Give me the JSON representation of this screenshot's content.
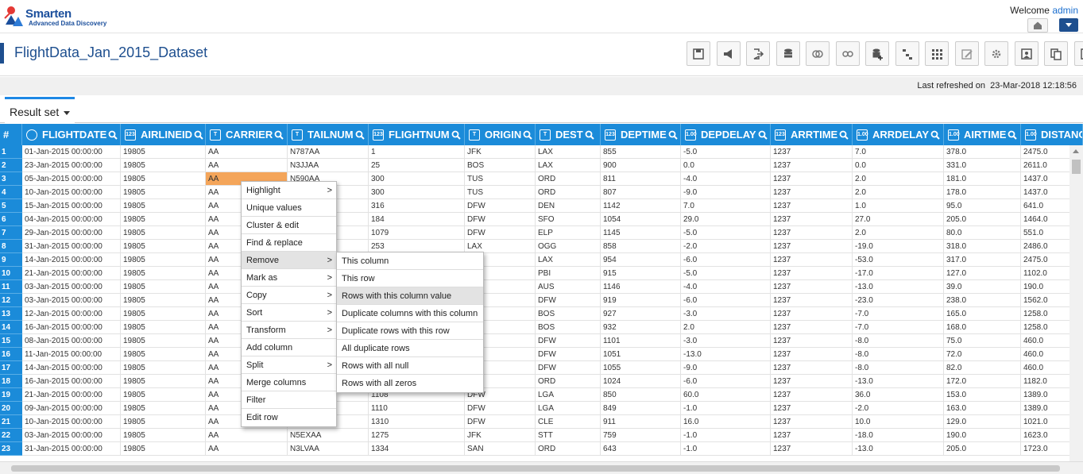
{
  "app": {
    "brand": "Smarten",
    "tagline": "Advanced Data Discovery"
  },
  "header": {
    "welcome": "Welcome",
    "user": "admin"
  },
  "page": {
    "title": "FlightData_Jan_2015_Dataset",
    "last_refreshed_label": "Last refreshed on",
    "last_refreshed_value": "23-Mar-2018 12:18:56"
  },
  "toolbar": {
    "icons": [
      "save-icon",
      "megaphone-icon",
      "export-icon",
      "database-icon",
      "circles-icon",
      "link-icon",
      "add-db-icon",
      "hierarchy-icon",
      "grid-icon",
      "edit-image-icon",
      "settings-icon",
      "picture-icon",
      "copy-icon",
      "columns-icon"
    ]
  },
  "tabs": {
    "result_set": "Result set"
  },
  "columns": [
    {
      "name": "#",
      "type": ""
    },
    {
      "name": "FLIGHTDATE",
      "type": "clock"
    },
    {
      "name": "AIRLINEID",
      "type": "123"
    },
    {
      "name": "CARRIER",
      "type": "T"
    },
    {
      "name": "TAILNUM",
      "type": "T"
    },
    {
      "name": "FLIGHTNUM",
      "type": "123"
    },
    {
      "name": "ORIGIN",
      "type": "T"
    },
    {
      "name": "DEST",
      "type": "T"
    },
    {
      "name": "DEPTIME",
      "type": "123"
    },
    {
      "name": "DEPDELAY",
      "type": "1.00"
    },
    {
      "name": "ARRTIME",
      "type": "123"
    },
    {
      "name": "ARRDELAY",
      "type": "1.00"
    },
    {
      "name": "AIRTIME",
      "type": "1.00"
    },
    {
      "name": "DISTANC",
      "type": "1.00"
    }
  ],
  "rows": [
    [
      "1",
      "01-Jan-2015 00:00:00",
      "19805",
      "AA",
      "N787AA",
      "1",
      "JFK",
      "LAX",
      "855",
      "-5.0",
      "1237",
      "7.0",
      "378.0",
      "2475.0"
    ],
    [
      "2",
      "23-Jan-2015 00:00:00",
      "19805",
      "AA",
      "N3JJAA",
      "25",
      "BOS",
      "LAX",
      "900",
      "0.0",
      "1237",
      "0.0",
      "331.0",
      "2611.0"
    ],
    [
      "3",
      "05-Jan-2015 00:00:00",
      "19805",
      "AA",
      "N590AA",
      "300",
      "TUS",
      "ORD",
      "811",
      "-4.0",
      "1237",
      "2.0",
      "181.0",
      "1437.0"
    ],
    [
      "4",
      "10-Jan-2015 00:00:00",
      "19805",
      "AA",
      "",
      "300",
      "TUS",
      "ORD",
      "807",
      "-9.0",
      "1237",
      "2.0",
      "178.0",
      "1437.0"
    ],
    [
      "5",
      "15-Jan-2015 00:00:00",
      "19805",
      "AA",
      "",
      "316",
      "DFW",
      "DEN",
      "1142",
      "7.0",
      "1237",
      "1.0",
      "95.0",
      "641.0"
    ],
    [
      "6",
      "04-Jan-2015 00:00:00",
      "19805",
      "AA",
      "",
      "184",
      "DFW",
      "SFO",
      "1054",
      "29.0",
      "1237",
      "27.0",
      "205.0",
      "1464.0"
    ],
    [
      "7",
      "29-Jan-2015 00:00:00",
      "19805",
      "AA",
      "",
      "1079",
      "DFW",
      "ELP",
      "1145",
      "-5.0",
      "1237",
      "2.0",
      "80.0",
      "551.0"
    ],
    [
      "8",
      "31-Jan-2015 00:00:00",
      "19805",
      "AA",
      "",
      "253",
      "LAX",
      "OGG",
      "858",
      "-2.0",
      "1237",
      "-19.0",
      "318.0",
      "2486.0"
    ],
    [
      "9",
      "14-Jan-2015 00:00:00",
      "19805",
      "AA",
      "",
      "",
      "",
      "LAX",
      "954",
      "-6.0",
      "1237",
      "-53.0",
      "317.0",
      "2475.0"
    ],
    [
      "10",
      "21-Jan-2015 00:00:00",
      "19805",
      "AA",
      "",
      "",
      "",
      "PBI",
      "915",
      "-5.0",
      "1237",
      "-17.0",
      "127.0",
      "1102.0"
    ],
    [
      "11",
      "03-Jan-2015 00:00:00",
      "19805",
      "AA",
      "",
      "",
      "",
      "AUS",
      "1146",
      "-4.0",
      "1237",
      "-13.0",
      "39.0",
      "190.0"
    ],
    [
      "12",
      "03-Jan-2015 00:00:00",
      "19805",
      "AA",
      "",
      "",
      "",
      "DFW",
      "919",
      "-6.0",
      "1237",
      "-23.0",
      "238.0",
      "1562.0"
    ],
    [
      "13",
      "12-Jan-2015 00:00:00",
      "19805",
      "AA",
      "",
      "",
      "",
      "BOS",
      "927",
      "-3.0",
      "1237",
      "-7.0",
      "165.0",
      "1258.0"
    ],
    [
      "14",
      "16-Jan-2015 00:00:00",
      "19805",
      "AA",
      "",
      "",
      "",
      "BOS",
      "932",
      "2.0",
      "1237",
      "-7.0",
      "168.0",
      "1258.0"
    ],
    [
      "15",
      "08-Jan-2015 00:00:00",
      "19805",
      "AA",
      "",
      "",
      "",
      "DFW",
      "1101",
      "-3.0",
      "1237",
      "-8.0",
      "75.0",
      "460.0"
    ],
    [
      "16",
      "11-Jan-2015 00:00:00",
      "19805",
      "AA",
      "",
      "",
      "",
      "DFW",
      "1051",
      "-13.0",
      "1237",
      "-8.0",
      "72.0",
      "460.0"
    ],
    [
      "17",
      "14-Jan-2015 00:00:00",
      "19805",
      "AA",
      "",
      "",
      "",
      "DFW",
      "1055",
      "-9.0",
      "1237",
      "-8.0",
      "82.0",
      "460.0"
    ],
    [
      "18",
      "16-Jan-2015 00:00:00",
      "19805",
      "AA",
      "",
      "",
      "",
      "ORD",
      "1024",
      "-6.0",
      "1237",
      "-13.0",
      "172.0",
      "1182.0"
    ],
    [
      "19",
      "21-Jan-2015 00:00:00",
      "19805",
      "AA",
      "",
      "1108",
      "DFW",
      "LGA",
      "850",
      "60.0",
      "1237",
      "36.0",
      "153.0",
      "1389.0"
    ],
    [
      "20",
      "09-Jan-2015 00:00:00",
      "19805",
      "AA",
      "",
      "1110",
      "DFW",
      "LGA",
      "849",
      "-1.0",
      "1237",
      "-2.0",
      "163.0",
      "1389.0"
    ],
    [
      "21",
      "10-Jan-2015 00:00:00",
      "19805",
      "AA",
      "",
      "1310",
      "DFW",
      "CLE",
      "911",
      "16.0",
      "1237",
      "10.0",
      "129.0",
      "1021.0"
    ],
    [
      "22",
      "03-Jan-2015 00:00:00",
      "19805",
      "AA",
      "N5EXAA",
      "1275",
      "JFK",
      "STT",
      "759",
      "-1.0",
      "1237",
      "-18.0",
      "190.0",
      "1623.0"
    ],
    [
      "23",
      "31-Jan-2015 00:00:00",
      "19805",
      "AA",
      "N3LVAA",
      "1334",
      "SAN",
      "ORD",
      "643",
      "-1.0",
      "1237",
      "-13.0",
      "205.0",
      "1723.0"
    ]
  ],
  "context_menu": {
    "items": [
      {
        "label": "Highlight",
        "arrow": ">"
      },
      {
        "label": "Unique values",
        "arrow": ""
      },
      {
        "label": "Cluster & edit",
        "arrow": ""
      },
      {
        "label": "Find & replace",
        "arrow": ""
      },
      {
        "label": "Remove",
        "arrow": ">"
      },
      {
        "label": "Mark as",
        "arrow": ">"
      },
      {
        "label": "Copy",
        "arrow": ">"
      },
      {
        "label": "Sort",
        "arrow": ">"
      },
      {
        "label": "Transform",
        "arrow": ">"
      },
      {
        "label": "Add column",
        "arrow": ""
      },
      {
        "label": "Split",
        "arrow": ">"
      },
      {
        "label": "Merge columns",
        "arrow": ""
      },
      {
        "label": "Filter",
        "arrow": ""
      },
      {
        "label": "Edit row",
        "arrow": ""
      }
    ],
    "active_index": 4
  },
  "submenu": {
    "items": [
      "This column",
      "This row",
      "Rows with this column value",
      "Duplicate columns with this column",
      "Duplicate rows with this row",
      "All duplicate rows",
      "Rows with all null",
      "Rows with all zeros"
    ],
    "active_index": 2
  }
}
